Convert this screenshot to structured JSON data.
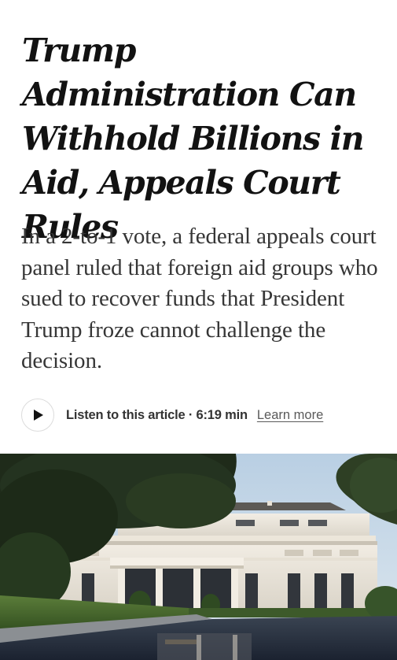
{
  "article": {
    "headline": "Trump Administration Can Withhold Billions in Aid, Appeals Court Rules",
    "summary": "In a 2-to-1 vote, a federal appeals court panel ruled that foreign aid groups who sued to recover funds that President Trump froze cannot challenge the decision."
  },
  "audio": {
    "listen_label": "Listen to this article · 6:19 min",
    "learn_more": "Learn more",
    "play_icon": "play-icon"
  },
  "image": {
    "subject": "west-wing-photo"
  }
}
